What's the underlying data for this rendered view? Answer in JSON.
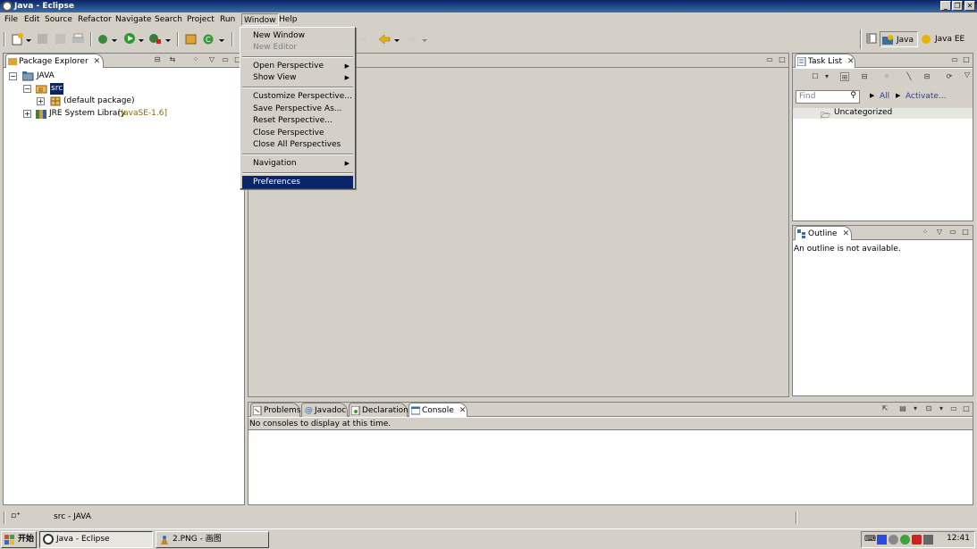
{
  "window": {
    "title": "Java - Eclipse"
  },
  "menubar": [
    "File",
    "Edit",
    "Source",
    "Refactor",
    "Navigate",
    "Search",
    "Project",
    "Run",
    "Window",
    "Help"
  ],
  "window_menu": {
    "items": [
      {
        "label": "New Window"
      },
      {
        "label": "New Editor",
        "disabled": true
      },
      {
        "label": "Open Perspective",
        "submenu": true
      },
      {
        "label": "Show View",
        "submenu": true
      },
      {
        "label": "Customize Perspective..."
      },
      {
        "label": "Save Perspective As..."
      },
      {
        "label": "Reset Perspective..."
      },
      {
        "label": "Close Perspective"
      },
      {
        "label": "Close All Perspectives"
      },
      {
        "label": "Navigation",
        "submenu": true
      },
      {
        "label": "Preferences",
        "highlighted": true
      }
    ]
  },
  "perspectives": [
    "Java",
    "Java EE"
  ],
  "package_explorer": {
    "tab": "Package Explorer",
    "tree": [
      {
        "label": "JAVA",
        "level": 0,
        "expander": "−"
      },
      {
        "label": "src",
        "level": 1,
        "expander": "−",
        "selected": true
      },
      {
        "label": "(default package)",
        "level": 2,
        "expander": "+"
      },
      {
        "label": "JRE System Library",
        "suffix": "[JavaSE-1.6]",
        "level": 1,
        "expander": "+"
      }
    ]
  },
  "task_list": {
    "tab": "Task List",
    "find_placeholder": "Find",
    "all_label": "All",
    "activate_label": "Activate...",
    "category": "Uncategorized"
  },
  "outline": {
    "tab": "Outline",
    "message": "An outline is not available."
  },
  "bottom_tabs": [
    "Problems",
    "Javadoc",
    "Declaration",
    "Console"
  ],
  "console": {
    "message": "No consoles to display at this time."
  },
  "status": {
    "text": "src - JAVA"
  },
  "taskbar": {
    "start": "开始",
    "buttons": [
      "Java - Eclipse",
      "2.PNG - 画图"
    ],
    "clock": "12:41"
  }
}
